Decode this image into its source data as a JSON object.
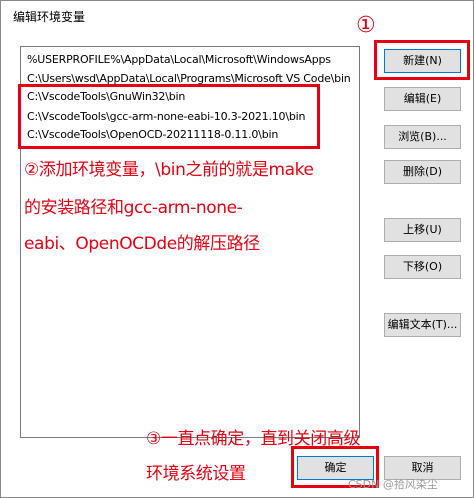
{
  "window": {
    "title": "编辑环境变量"
  },
  "paths": [
    "%USERPROFILE%\\AppData\\Local\\Microsoft\\WindowsApps",
    "C:\\Users\\wsd\\AppData\\Local\\Programs\\Microsoft VS Code\\bin",
    "C:\\VscodeTools\\GnuWin32\\bin",
    "C:\\VscodeTools\\gcc-arm-none-eabi-10.3-2021.10\\bin",
    "C:\\VscodeTools\\OpenOCD-20211118-0.11.0\\bin"
  ],
  "buttons": {
    "new": "新建(N)",
    "edit": "编辑(E)",
    "browse": "浏览(B)...",
    "delete": "删除(D)",
    "move_up": "上移(U)",
    "move_down": "下移(O)",
    "edit_text": "编辑文本(T)...",
    "ok": "确定",
    "cancel": "取消"
  },
  "annotations": {
    "step1": "①",
    "step2_line1": "②添加环境变量，\\bin之前的就是make",
    "step2_line2": "的安装路径和gcc-arm-none-",
    "step2_line3": "eabi、OpenOCDde的解压路径",
    "step3_line1": "③一直点确定，直到关闭高级",
    "step3_line2": "环境系统设置"
  },
  "watermark": "CSDN @拾风染尘",
  "colors": {
    "annotation_red": "#e60012",
    "focus_blue": "#0078d7",
    "button_bg": "#e1e1e1"
  }
}
